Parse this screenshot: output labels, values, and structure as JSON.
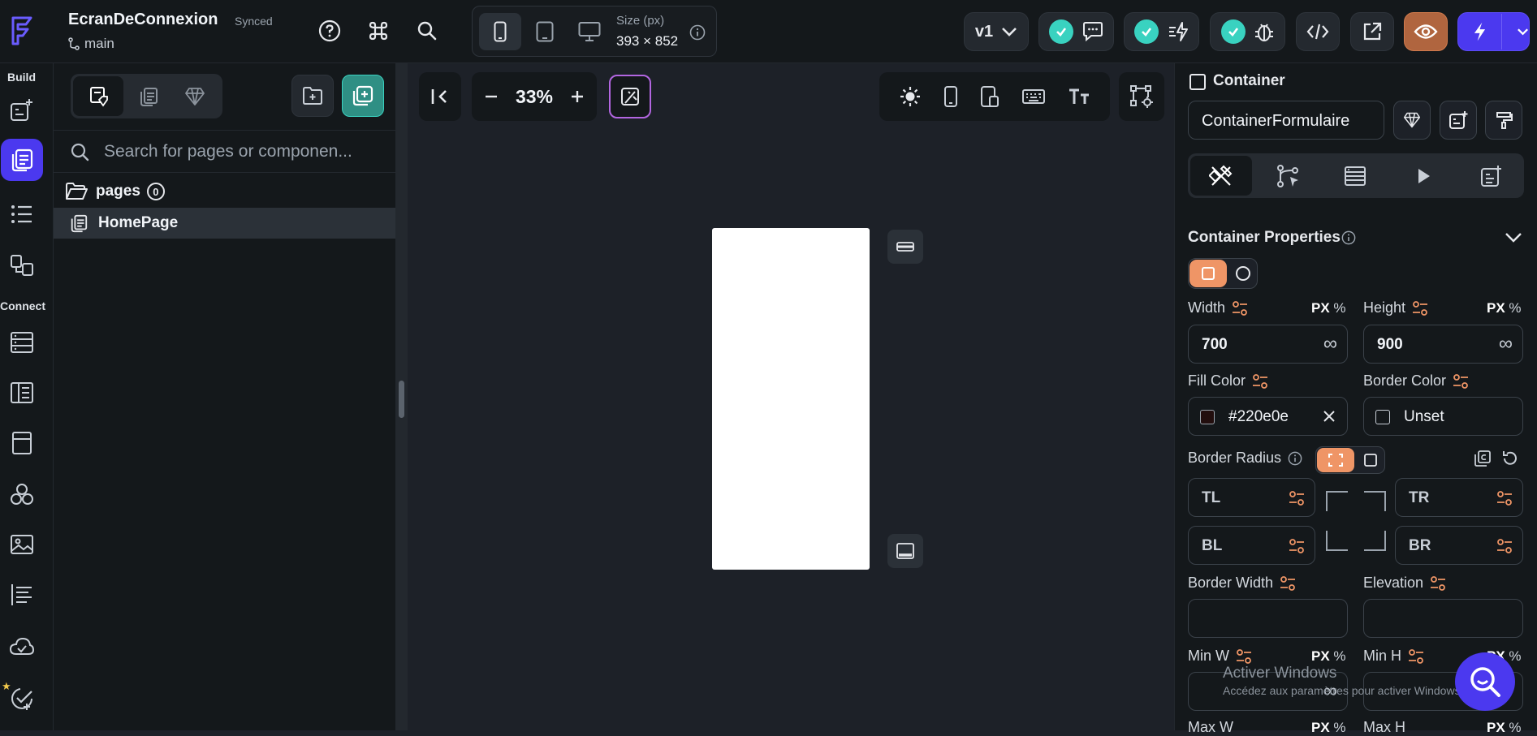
{
  "header": {
    "project_name": "EcranDeConnexion",
    "sync_status": "Synced",
    "branch": "main",
    "size_label": "Size (px)",
    "size_value": "393 × 852",
    "version": "v1"
  },
  "left_nav": {
    "build_label": "Build",
    "connect_label": "Connect"
  },
  "pages_panel": {
    "search_placeholder": "Search for pages or componen...",
    "folder_name": "pages",
    "folder_count": "0",
    "page_name": "HomePage"
  },
  "canvas": {
    "zoom": "33%"
  },
  "properties": {
    "widget_type": "Container",
    "widget_name": "ContainerFormulaire",
    "section_title": "Container Properties",
    "width_label": "Width",
    "height_label": "Height",
    "unit_px": "PX",
    "unit_pct": "%",
    "width_value": "700",
    "height_value": "900",
    "infinity": "∞",
    "fill_color_label": "Fill Color",
    "fill_color_value": "#220e0e",
    "border_color_label": "Border Color",
    "border_color_value": "Unset",
    "border_radius_label": "Border Radius",
    "tl": "TL",
    "tr": "TR",
    "bl": "BL",
    "br": "BR",
    "border_width_label": "Border Width",
    "elevation_label": "Elevation",
    "min_w_label": "Min W",
    "min_h_label": "Min H",
    "max_w_label": "Max W",
    "max_h_label": "Max H"
  },
  "watermark": {
    "line1": "Activer Windows",
    "line2": "Accédez aux paramètres pour activer Windows."
  },
  "colors": {
    "accent": "#4b39ef",
    "teal": "#39d2c0",
    "orange": "#ef9566",
    "fill_swatch": "#220e0e"
  }
}
